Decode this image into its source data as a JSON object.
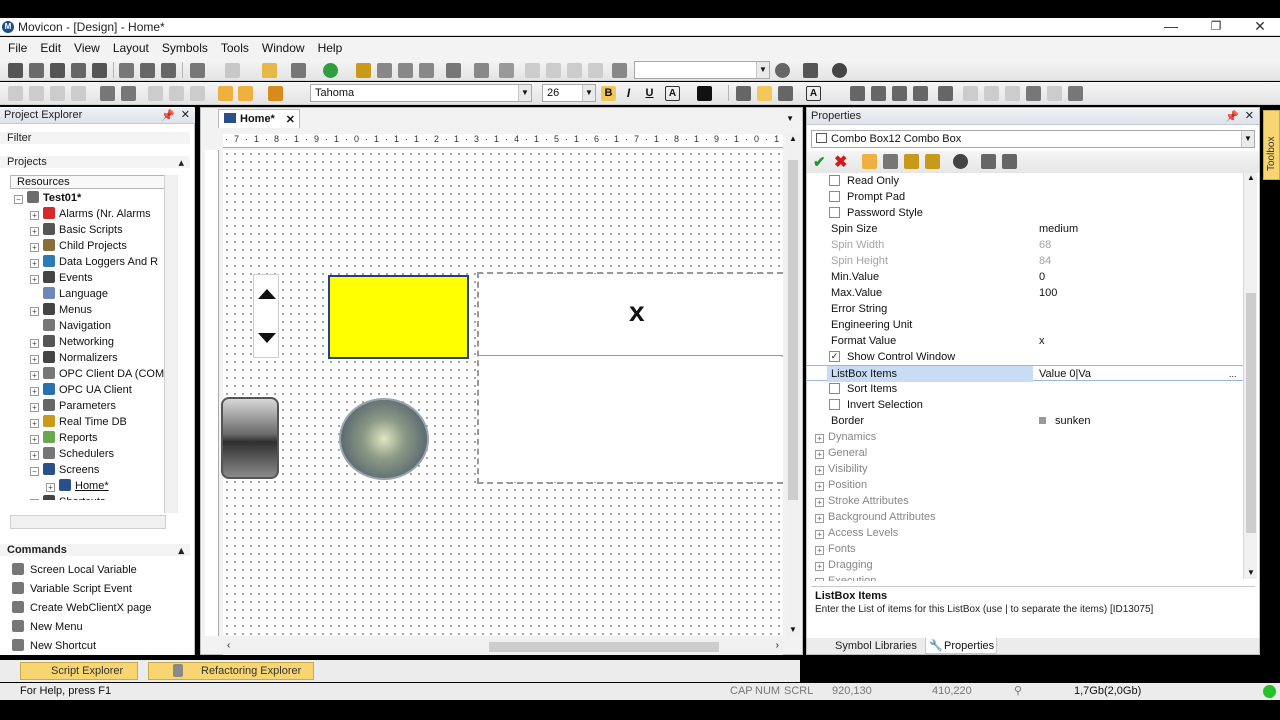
{
  "window": {
    "title": "Movicon - [Design] - Home*",
    "app_icon_label": "M"
  },
  "window_controls": {
    "minimize": "—",
    "restore": "❐",
    "close": "✕"
  },
  "menu": [
    "File",
    "Edit",
    "View",
    "Layout",
    "Symbols",
    "Tools",
    "Window",
    "Help"
  ],
  "toolbar": {
    "font_name": "Tahoma",
    "font_size": "26",
    "bold": "B",
    "italic": "I",
    "underline": "U",
    "text_tool": "A"
  },
  "project_explorer": {
    "title": "Project Explorer",
    "filter_label": "Filter",
    "projects_label": "Projects",
    "resources_label": "Resources",
    "tree": [
      {
        "label": "Test01*",
        "level": 0,
        "expander": "−",
        "color": "#6d6d6d"
      },
      {
        "label": "Alarms (Nr. Alarms ",
        "level": 1,
        "expander": "+",
        "color": "#d42a2a"
      },
      {
        "label": "Basic Scripts",
        "level": 1,
        "expander": "+",
        "color": "#555555"
      },
      {
        "label": "Child Projects",
        "level": 1,
        "expander": "+",
        "color": "#8a6d3b"
      },
      {
        "label": "Data Loggers And R",
        "level": 1,
        "expander": "+",
        "color": "#2c7bb6"
      },
      {
        "label": "Events",
        "level": 1,
        "expander": "+",
        "color": "#444444"
      },
      {
        "label": "Language",
        "level": 1,
        "expander": "",
        "color": "#6d88b8"
      },
      {
        "label": "Menus",
        "level": 1,
        "expander": "+",
        "color": "#444444"
      },
      {
        "label": "Navigation",
        "level": 1,
        "expander": "",
        "color": "#777777"
      },
      {
        "label": "Networking",
        "level": 1,
        "expander": "+",
        "color": "#555555"
      },
      {
        "label": "Normalizers",
        "level": 1,
        "expander": "+",
        "color": "#444444"
      },
      {
        "label": "OPC Client DA (COM",
        "level": 1,
        "expander": "+",
        "color": "#777777"
      },
      {
        "label": "OPC UA Client",
        "level": 1,
        "expander": "+",
        "color": "#2a6fb0"
      },
      {
        "label": "Parameters",
        "level": 1,
        "expander": "+",
        "color": "#666666"
      },
      {
        "label": "Real Time DB",
        "level": 1,
        "expander": "+",
        "color": "#c79a1a"
      },
      {
        "label": "Reports",
        "level": 1,
        "expander": "+",
        "color": "#6aa84f"
      },
      {
        "label": "Schedulers",
        "level": 1,
        "expander": "+",
        "color": "#777777"
      },
      {
        "label": "Screens",
        "level": 1,
        "expander": "−",
        "color": "#2a4f8a"
      },
      {
        "label": "Home*",
        "level": 2,
        "expander": "+",
        "color": "#2a4f8a"
      },
      {
        "label": "Shortcuts",
        "level": 1,
        "expander": "+",
        "color": "#444444"
      }
    ]
  },
  "commands": {
    "title": "Commands",
    "items": [
      "Screen Local Variable",
      "Variable Script Event",
      "Create WebClientX page",
      "New Menu",
      "New Shortcut"
    ]
  },
  "document": {
    "tab_label": "Home*",
    "close_glyph": "✕",
    "ruler_text": "·7·1·8·1·9·1·0·1·1·1·2·1·3·1·4·1·5·1·6·1·7·1·8·1·9·1·0·1·1·1·2·1·3·1·4·1·5",
    "combo_value": "x"
  },
  "properties": {
    "title": "Properties",
    "object": "Combo Box12 Combo Box",
    "rows": [
      {
        "type": "check",
        "name": "Read Only",
        "checked": false
      },
      {
        "type": "check",
        "name": "Prompt Pad",
        "checked": false
      },
      {
        "type": "check",
        "name": "Password Style",
        "checked": false
      },
      {
        "type": "value",
        "name": "Spin Size",
        "value": "medium",
        "disabled": false
      },
      {
        "type": "value",
        "name": "Spin Width",
        "value": "68",
        "disabled": true
      },
      {
        "type": "value",
        "name": "Spin Height",
        "value": "84",
        "disabled": true
      },
      {
        "type": "value",
        "name": "Min.Value",
        "value": "0",
        "disabled": false
      },
      {
        "type": "value",
        "name": "Max.Value",
        "value": "100",
        "disabled": false
      },
      {
        "type": "value",
        "name": "Error String",
        "value": "",
        "disabled": false
      },
      {
        "type": "value",
        "name": "Engineering Unit",
        "value": "",
        "disabled": false
      },
      {
        "type": "value",
        "name": "Format Value",
        "value": "x",
        "disabled": false
      },
      {
        "type": "check",
        "name": "Show Control Window",
        "checked": true
      },
      {
        "type": "edit",
        "name": "ListBox Items",
        "value": "Value 0|Va"
      },
      {
        "type": "check",
        "name": "Sort Items",
        "checked": false
      },
      {
        "type": "check",
        "name": "Invert Selection",
        "checked": false
      },
      {
        "type": "value",
        "name": "Border",
        "value": "sunken",
        "disabled": false
      }
    ],
    "groups": [
      "Dynamics",
      "General",
      "Visibility",
      "Position",
      "Stroke Attributes",
      "Background Attributes",
      "Access Levels",
      "Fonts",
      "Dragging",
      "Execution"
    ],
    "help_title": "ListBox Items",
    "help_text": "Enter the List of items for this ListBox (use | to separate the items) [ID13075]",
    "tabs": [
      "Symbol Libraries",
      "Properties"
    ]
  },
  "bottom_tabs": [
    "Script Explorer",
    "Refactoring Explorer"
  ],
  "toolbox_label": "Toolbox",
  "status": {
    "help": "For Help, press F1",
    "cap": "CAP",
    "num": "NUM",
    "scrl": "SCRL",
    "pos": "920,130",
    "size": "410,220",
    "memory": "1,7Gb(2,0Gb)"
  }
}
